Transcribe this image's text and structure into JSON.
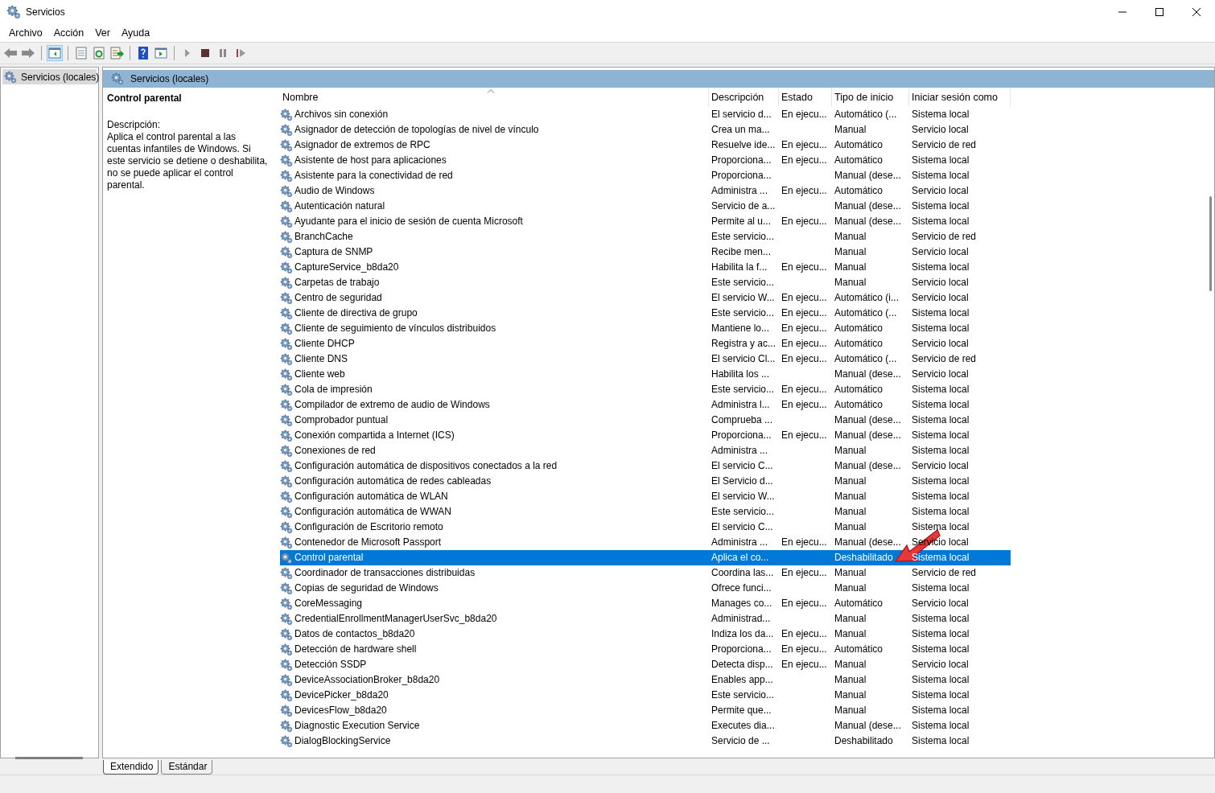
{
  "window": {
    "title": "Servicios"
  },
  "menu": [
    "Archivo",
    "Acción",
    "Ver",
    "Ayuda"
  ],
  "tree": [
    {
      "label": "Servicios (locales)",
      "selected": true
    }
  ],
  "panel_title": "Servicios (locales)",
  "detail": {
    "title": "Control parental",
    "description_label": "Descripción:",
    "description": "Aplica el control parental a las cuentas infantiles de Windows. Si este servicio se detiene o deshabilita, no se puede aplicar el control parental."
  },
  "columns": [
    "Nombre",
    "Descripción",
    "Estado",
    "Tipo de inicio",
    "Iniciar sesión como"
  ],
  "rows": [
    {
      "name": "Archivos sin conexión",
      "description": "El servicio d...",
      "status": "En ejecu...",
      "startup": "Automático (...",
      "logon": "Sistema local",
      "selected": false
    },
    {
      "name": "Asignador de detección de topologías de nivel de vínculo",
      "description": "Crea un ma...",
      "startup": "Manual",
      "logon": "Servicio local",
      "selected": false
    },
    {
      "name": "Asignador de extremos de RPC",
      "description": "Resuelve ide...",
      "status": "En ejecu...",
      "startup": "Automático",
      "logon": "Servicio de red",
      "selected": false
    },
    {
      "name": "Asistente de host para aplicaciones",
      "description": "Proporciona...",
      "status": "En ejecu...",
      "startup": "Automático",
      "logon": "Sistema local",
      "selected": false
    },
    {
      "name": "Asistente para la conectividad de red",
      "description": "Proporciona...",
      "startup": "Manual (dese...",
      "logon": "Sistema local",
      "selected": false
    },
    {
      "name": "Audio de Windows",
      "description": "Administra ...",
      "status": "En ejecu...",
      "startup": "Automático",
      "logon": "Servicio local",
      "selected": false
    },
    {
      "name": "Autenticación natural",
      "description": "Servicio de a...",
      "startup": "Manual (dese...",
      "logon": "Sistema local",
      "selected": false
    },
    {
      "name": "Ayudante para el inicio de sesión de cuenta Microsoft",
      "description": "Permite al u...",
      "status": "En ejecu...",
      "startup": "Manual (dese...",
      "logon": "Sistema local",
      "selected": false
    },
    {
      "name": "BranchCache",
      "description": "Este servicio...",
      "startup": "Manual",
      "logon": "Servicio de red",
      "selected": false
    },
    {
      "name": "Captura de SNMP",
      "description": "Recibe men...",
      "startup": "Manual",
      "logon": "Servicio local",
      "selected": false
    },
    {
      "name": "CaptureService_b8da20",
      "description": "Habilita la f...",
      "status": "En ejecu...",
      "startup": "Manual",
      "logon": "Sistema local",
      "selected": false
    },
    {
      "name": "Carpetas de trabajo",
      "description": "Este servicio...",
      "startup": "Manual",
      "logon": "Servicio local",
      "selected": false
    },
    {
      "name": "Centro de seguridad",
      "description": "El servicio W...",
      "status": "En ejecu...",
      "startup": "Automático (i...",
      "logon": "Servicio local",
      "selected": false
    },
    {
      "name": "Cliente de directiva de grupo",
      "description": "Este servicio...",
      "status": "En ejecu...",
      "startup": "Automático (...",
      "logon": "Sistema local",
      "selected": false
    },
    {
      "name": "Cliente de seguimiento de vínculos distribuidos",
      "description": "Mantiene lo...",
      "status": "En ejecu...",
      "startup": "Automático",
      "logon": "Sistema local",
      "selected": false
    },
    {
      "name": "Cliente DHCP",
      "description": "Registra y ac...",
      "status": "En ejecu...",
      "startup": "Automático",
      "logon": "Servicio local",
      "selected": false
    },
    {
      "name": "Cliente DNS",
      "description": "El servicio Cl...",
      "status": "En ejecu...",
      "startup": "Automático (...",
      "logon": "Servicio de red",
      "selected": false
    },
    {
      "name": "Cliente web",
      "description": "Habilita los ...",
      "startup": "Manual (dese...",
      "logon": "Servicio local",
      "selected": false
    },
    {
      "name": "Cola de impresión",
      "description": "Este servicio...",
      "status": "En ejecu...",
      "startup": "Automático",
      "logon": "Sistema local",
      "selected": false
    },
    {
      "name": "Compilador de extremo de audio de Windows",
      "description": "Administra l...",
      "status": "En ejecu...",
      "startup": "Automático",
      "logon": "Sistema local",
      "selected": false
    },
    {
      "name": "Comprobador puntual",
      "description": "Comprueba ...",
      "startup": "Manual (dese...",
      "logon": "Sistema local",
      "selected": false
    },
    {
      "name": "Conexión compartida a Internet (ICS)",
      "description": "Proporciona...",
      "status": "En ejecu...",
      "startup": "Manual (dese...",
      "logon": "Sistema local",
      "selected": false
    },
    {
      "name": "Conexiones de red",
      "description": "Administra ...",
      "startup": "Manual",
      "logon": "Sistema local",
      "selected": false
    },
    {
      "name": "Configuración automática de dispositivos conectados a la red",
      "description": "El servicio C...",
      "startup": "Manual (dese...",
      "logon": "Servicio local",
      "selected": false
    },
    {
      "name": "Configuración automática de redes cableadas",
      "description": "El Servicio d...",
      "startup": "Manual",
      "logon": "Sistema local",
      "selected": false
    },
    {
      "name": "Configuración automática de WLAN",
      "description": "El servicio W...",
      "startup": "Manual",
      "logon": "Sistema local",
      "selected": false
    },
    {
      "name": "Configuración automática de WWAN",
      "description": "Este servicio...",
      "startup": "Manual",
      "logon": "Sistema local",
      "selected": false
    },
    {
      "name": "Configuración de Escritorio remoto",
      "description": "El servicio C...",
      "startup": "Manual",
      "logon": "Sistema local",
      "selected": false
    },
    {
      "name": "Contenedor de Microsoft Passport",
      "description": "Administra ...",
      "status": "En ejecu...",
      "startup": "Manual (dese...",
      "logon": "Servicio local",
      "selected": false
    },
    {
      "name": "Control parental",
      "description": "Aplica el co...",
      "startup": "Deshabilitado",
      "logon": "Sistema local",
      "selected": true
    },
    {
      "name": "Coordinador de transacciones distribuidas",
      "description": "Coordina las...",
      "status": "En ejecu...",
      "startup": "Manual",
      "logon": "Servicio de red",
      "selected": false
    },
    {
      "name": "Copias de seguridad de Windows",
      "description": "Ofrece funci...",
      "startup": "Manual",
      "logon": "Sistema local",
      "selected": false
    },
    {
      "name": "CoreMessaging",
      "description": "Manages co...",
      "status": "En ejecu...",
      "startup": "Automático",
      "logon": "Servicio local",
      "selected": false
    },
    {
      "name": "CredentialEnrollmentManagerUserSvc_b8da20",
      "description": "Administrad...",
      "startup": "Manual",
      "logon": "Sistema local",
      "selected": false
    },
    {
      "name": "Datos de contactos_b8da20",
      "description": "Indiza los da...",
      "status": "En ejecu...",
      "startup": "Manual",
      "logon": "Sistema local",
      "selected": false
    },
    {
      "name": "Detección de hardware shell",
      "description": "Proporciona...",
      "status": "En ejecu...",
      "startup": "Automático",
      "logon": "Sistema local",
      "selected": false
    },
    {
      "name": "Detección SSDP",
      "description": "Detecta disp...",
      "status": "En ejecu...",
      "startup": "Manual",
      "logon": "Servicio local",
      "selected": false
    },
    {
      "name": "DeviceAssociationBroker_b8da20",
      "description": "Enables app...",
      "startup": "Manual",
      "logon": "Sistema local",
      "selected": false
    },
    {
      "name": "DevicePicker_b8da20",
      "description": "Este servicio...",
      "startup": "Manual",
      "logon": "Sistema local",
      "selected": false
    },
    {
      "name": "DevicesFlow_b8da20",
      "description": "Permite que...",
      "startup": "Manual",
      "logon": "Sistema local",
      "selected": false
    },
    {
      "name": "Diagnostic Execution Service",
      "description": "Executes dia...",
      "startup": "Manual (dese...",
      "logon": "Sistema local",
      "selected": false
    },
    {
      "name": "DialogBlockingService",
      "description": "Servicio de ...",
      "startup": "Deshabilitado",
      "logon": "Sistema local",
      "selected": false
    }
  ],
  "tabs": [
    {
      "label": "Extendido",
      "selected": true
    },
    {
      "label": "Estándar",
      "selected": false
    }
  ]
}
